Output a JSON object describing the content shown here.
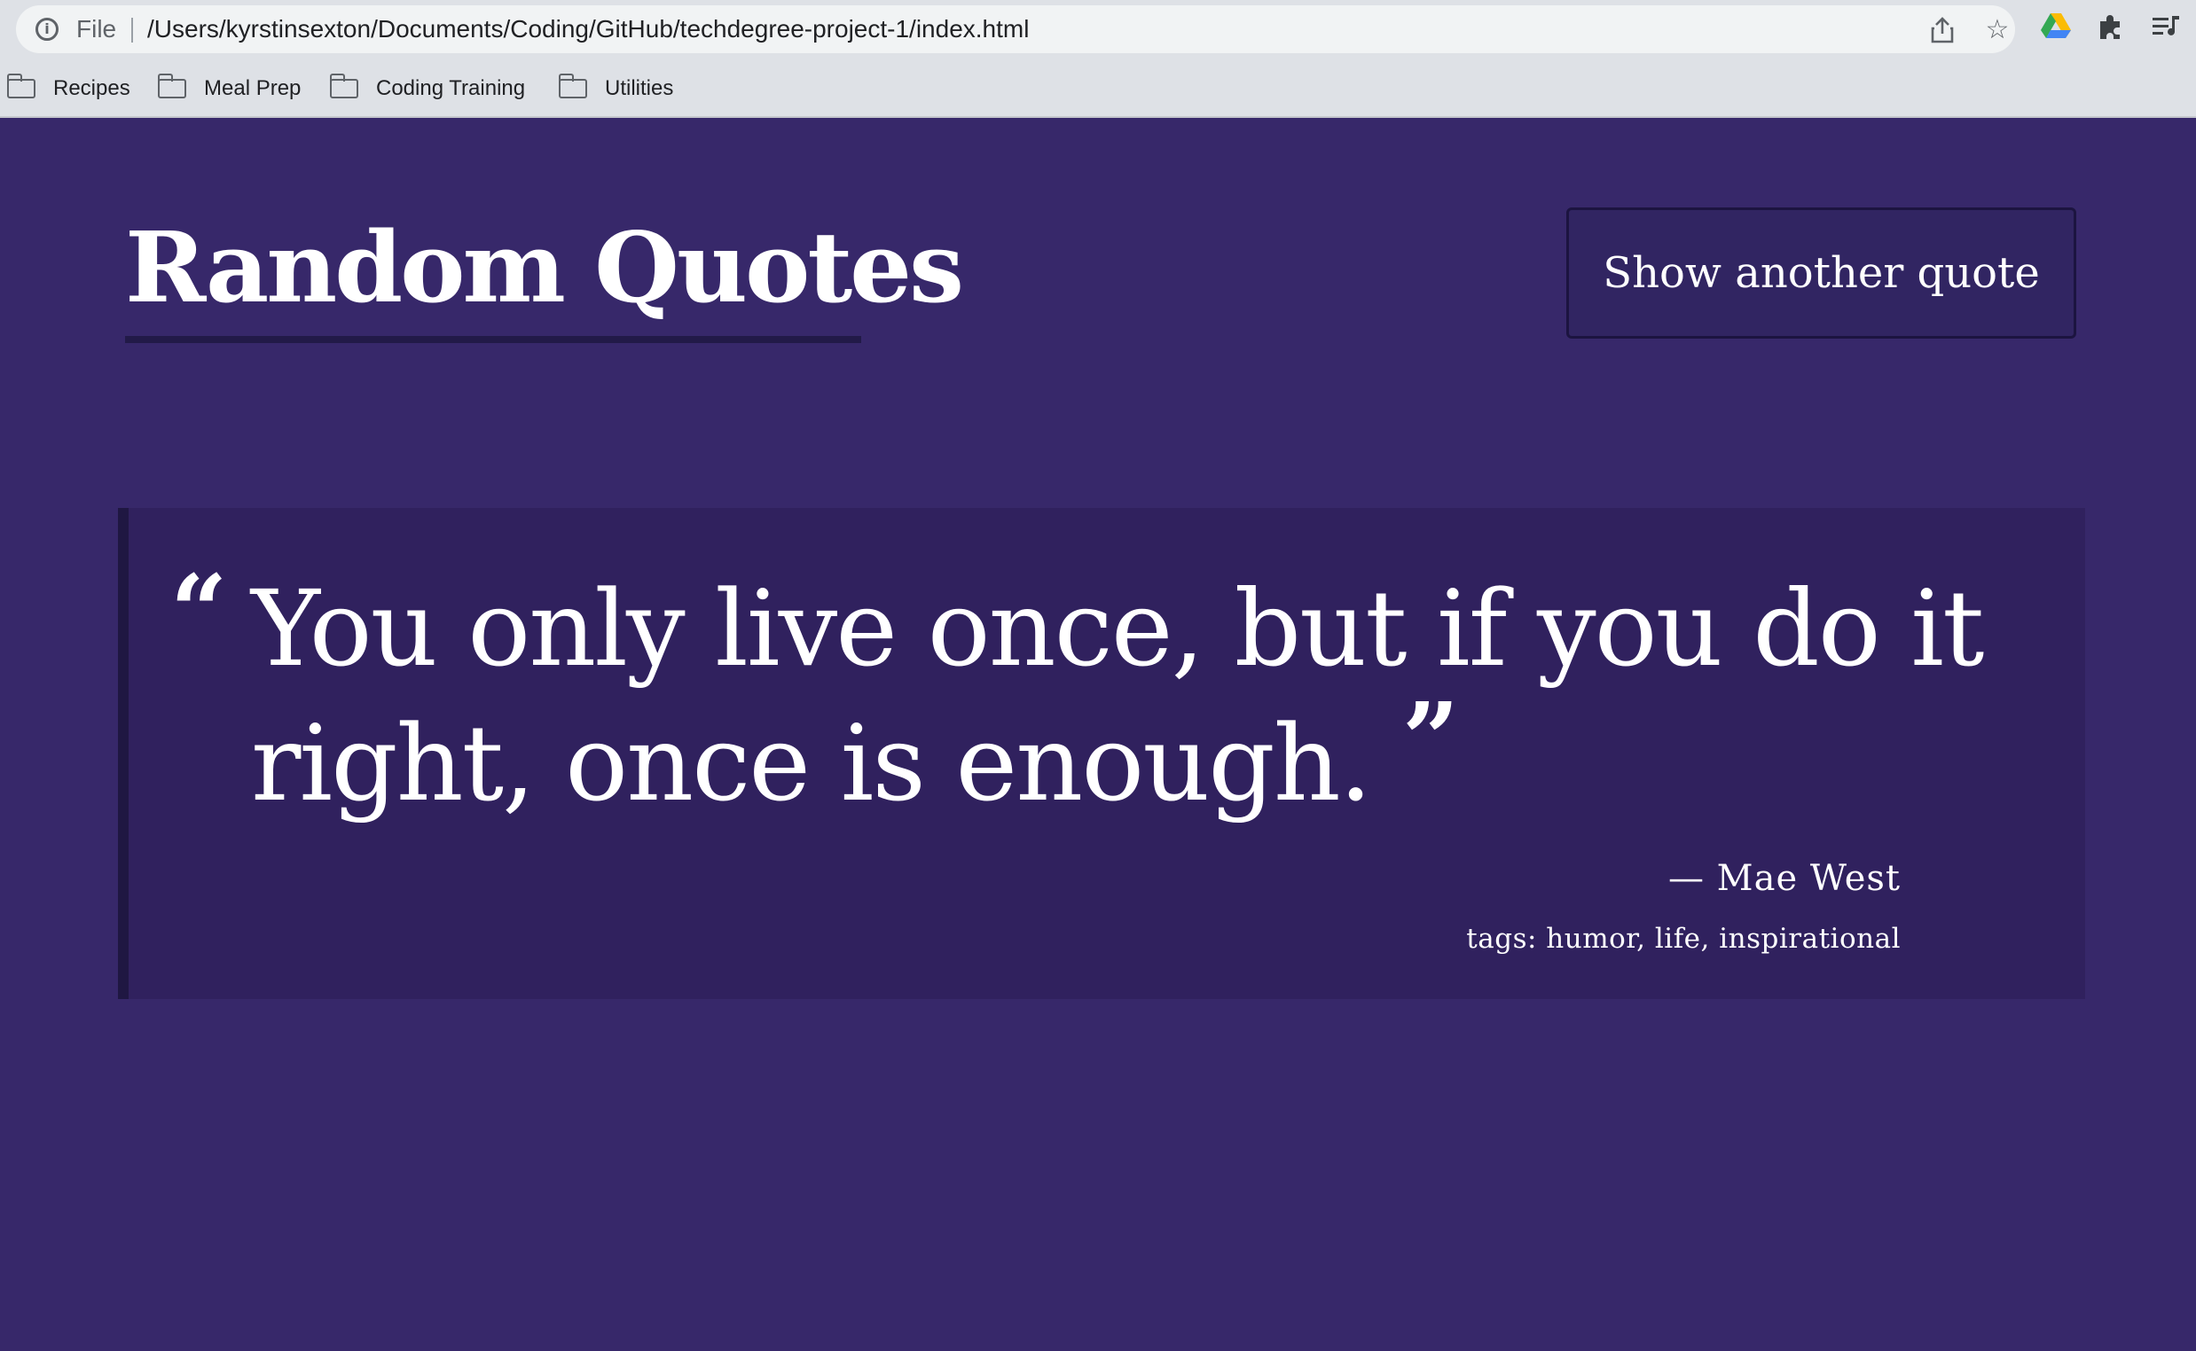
{
  "browser": {
    "scheme_label": "File",
    "url": "/Users/kyrstinsexton/Documents/Coding/GitHub/techdegree-project-1/index.html",
    "bookmarks": [
      {
        "label": "Recipes"
      },
      {
        "label": "Meal Prep"
      },
      {
        "label": "Coding Training"
      },
      {
        "label": "Utilities"
      }
    ],
    "icons": [
      "info-icon",
      "share-icon",
      "star-icon",
      "google-drive-icon",
      "extensions-icon",
      "reading-list-icon"
    ]
  },
  "page": {
    "title": "Random Quotes",
    "button_label": "Show another quote",
    "quote": {
      "open_mark": "“",
      "text": "You only live once, but if you do it right, once is enough.",
      "close_mark": "”",
      "source": "— Mae West",
      "tags": "tags: humor, life, inspirational"
    }
  },
  "colors": {
    "background": "#37286a",
    "quote_box": "#30215e",
    "text": "#ffffff",
    "accent_dark": "#221a48"
  }
}
